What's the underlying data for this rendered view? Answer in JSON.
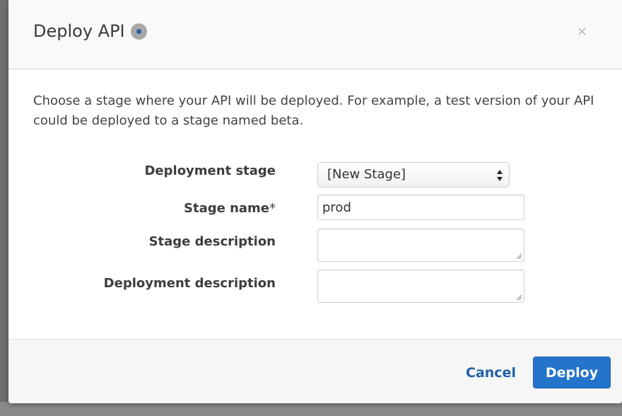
{
  "dialog": {
    "title": "Deploy API",
    "intro": "Choose a stage where your API will be deployed. For example, a test version of your API could be deployed to a stage named beta."
  },
  "form": {
    "deployment_stage": {
      "label": "Deployment stage",
      "value": "[New Stage]"
    },
    "stage_name": {
      "label": "Stage name",
      "required_mark": "*",
      "value": "prod"
    },
    "stage_description": {
      "label": "Stage description",
      "value": ""
    },
    "deployment_description": {
      "label": "Deployment description",
      "value": ""
    }
  },
  "footer": {
    "cancel_label": "Cancel",
    "deploy_label": "Deploy"
  },
  "icons": {
    "info": "info-icon",
    "close": "close-icon"
  },
  "colors": {
    "primary": "#2474cc",
    "link": "#1f5fa8"
  }
}
